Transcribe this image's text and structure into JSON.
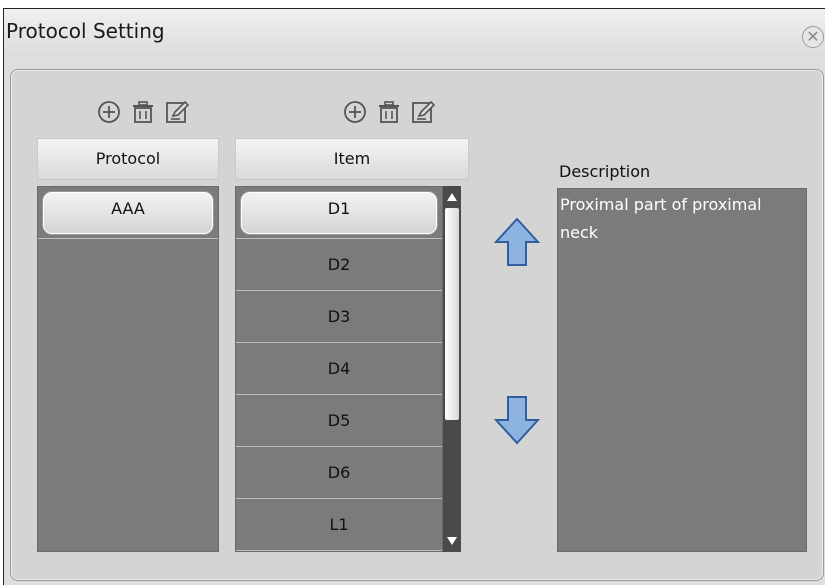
{
  "window": {
    "title": "Protocol Setting",
    "close_glyph": "✕"
  },
  "protocol": {
    "header": "Protocol",
    "items": [
      "AAA"
    ],
    "selected_index": 0,
    "toolbar": [
      "add-icon",
      "delete-icon",
      "edit-icon"
    ]
  },
  "item": {
    "header": "Item",
    "items": [
      "D1",
      "D2",
      "D3",
      "D4",
      "D5",
      "D6",
      "L1"
    ],
    "selected_index": 0,
    "toolbar": [
      "add-icon",
      "delete-icon",
      "edit-icon"
    ]
  },
  "description": {
    "label": "Description",
    "text": "Proximal part of proximal neck"
  },
  "colors": {
    "list_bg": "#7b7b7b",
    "arrow_fill": "#8db4e0",
    "arrow_stroke": "#2f5f9f"
  }
}
